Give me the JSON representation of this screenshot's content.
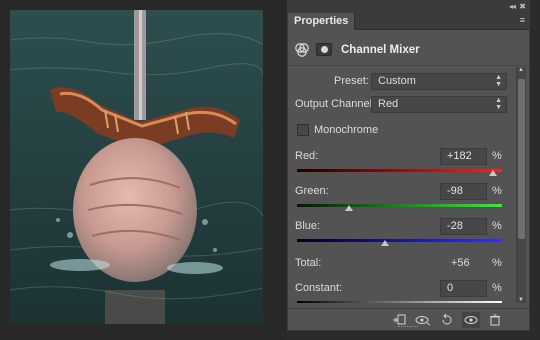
{
  "panel": {
    "tab_label": "Properties",
    "collapse_icon": "◂◂",
    "close_icon": "✖",
    "menu_icon": "≡",
    "title": "Channel Mixer"
  },
  "preset": {
    "label": "Preset:",
    "value": "Custom"
  },
  "output_channel": {
    "label": "Output Channel:",
    "value": "Red"
  },
  "monochrome": {
    "label": "Monochrome",
    "checked": false
  },
  "channels": [
    {
      "name": "Red:",
      "value": "+182",
      "unit": "%",
      "slider_level": 0.955,
      "color_start": "#1a0000",
      "color_end": "#ff2020"
    },
    {
      "name": "Green:",
      "value": "-98",
      "unit": "%",
      "slider_level": 0.255,
      "color_start": "#001a00",
      "color_end": "#20ff20"
    },
    {
      "name": "Blue:",
      "value": "-28",
      "unit": "%",
      "slider_level": 0.43,
      "color_start": "#00001a",
      "color_end": "#3030ff"
    }
  ],
  "total": {
    "label": "Total:",
    "value": "+56",
    "unit": "%"
  },
  "constant": {
    "label": "Constant:",
    "value": "0",
    "unit": "%"
  },
  "footer_icons": [
    "clip-to-layer-icon",
    "view-previous-state-icon",
    "reset-icon",
    "toggle-visibility-icon",
    "delete-icon"
  ],
  "colors": {
    "panel_bg": "#535353",
    "dark_bg": "#3b3b3b",
    "field_bg": "#474747"
  }
}
